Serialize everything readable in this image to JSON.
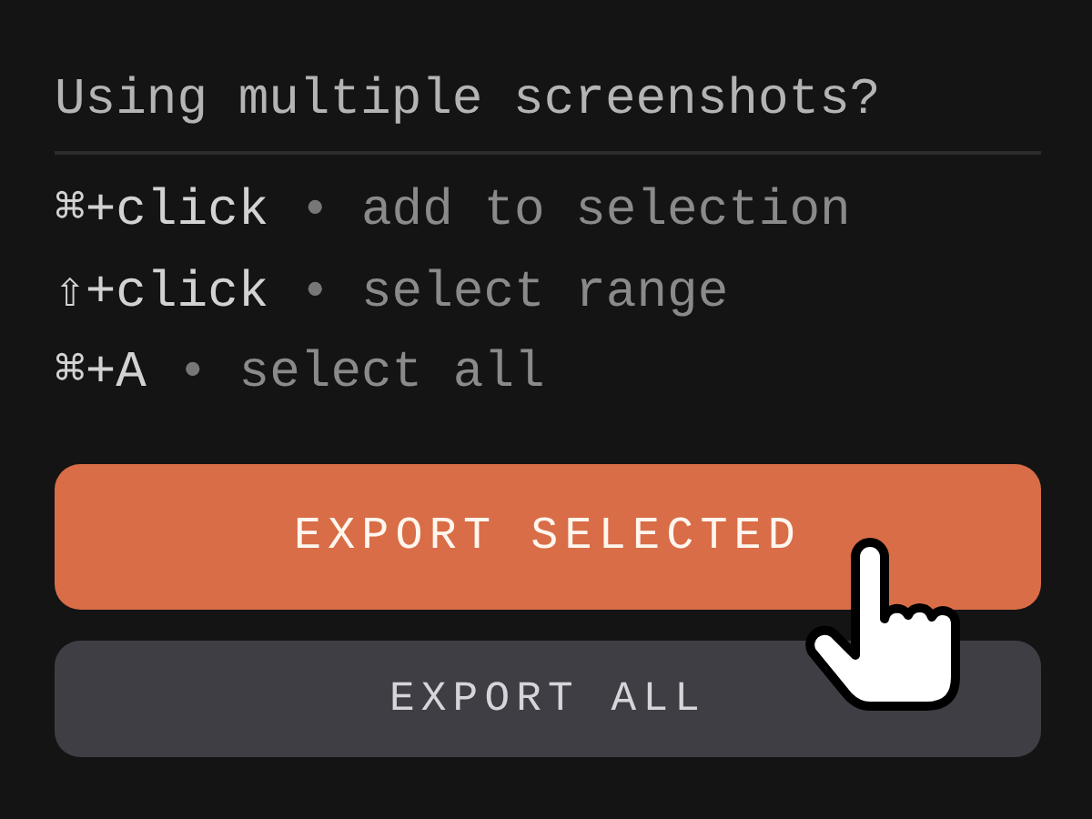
{
  "heading": "Using multiple screenshots?",
  "shortcuts": [
    {
      "keys": "⌘+click",
      "separator": "•",
      "action": "add to selection"
    },
    {
      "keys": "⇧+click",
      "separator": "•",
      "action": "select range"
    },
    {
      "keys": "⌘+A",
      "separator": "•",
      "action": "select all"
    }
  ],
  "buttons": [
    {
      "label": "EXPORT SELECTED",
      "kind": "primary"
    },
    {
      "label": "EXPORT ALL",
      "kind": "secondary"
    }
  ]
}
